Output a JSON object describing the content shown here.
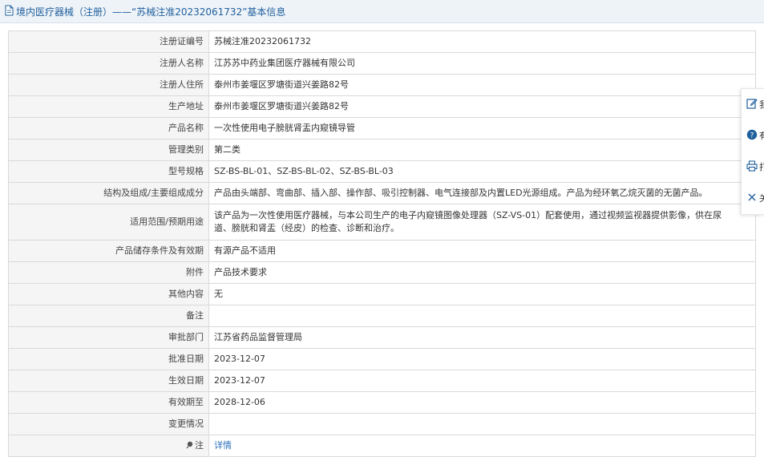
{
  "header": {
    "title": "境内医疗器械（注册）——“苏械注准20232061732”基本信息",
    "icon": "document-icon"
  },
  "rows": [
    {
      "label": "注册证编号",
      "value": "苏械注准20232061732"
    },
    {
      "label": "注册人名称",
      "value": "江苏苏中药业集团医疗器械有限公司"
    },
    {
      "label": "注册人住所",
      "value": "泰州市姜堰区罗塘街道兴姜路82号"
    },
    {
      "label": "生产地址",
      "value": "泰州市姜堰区罗塘街道兴姜路82号"
    },
    {
      "label": "产品名称",
      "value": "一次性使用电子膀胱肾盂内窥镜导管"
    },
    {
      "label": "管理类别",
      "value": "第二类"
    },
    {
      "label": "型号规格",
      "value": "SZ-BS-BL-01、SZ-BS-BL-02、SZ-BS-BL-03"
    },
    {
      "label": "结构及组成/主要组成成分",
      "value": "产品由头端部、弯曲部、插入部、操作部、吸引控制器、电气连接部及内置LED光源组成。产品为经环氧乙烷灭菌的无菌产品。"
    },
    {
      "label": "适用范围/预期用途",
      "value_lines": [
        "该产品为一次性使用医疗器械，与本公司生产的电子内窥镜图像处理器（SZ-VS-01）配套使用，通过视频监视器提供影像，供在尿",
        "道、膀胱和肾盂（经皮）的检查、诊断和治疗。"
      ]
    },
    {
      "label": "产品储存条件及有效期",
      "value": "有源产品不适用"
    },
    {
      "label": "附件",
      "value": "产品技术要求"
    },
    {
      "label": "其他内容",
      "value": "无"
    },
    {
      "label": "备注",
      "value": ""
    },
    {
      "label": "审批部门",
      "value": "江苏省药品监督管理局"
    },
    {
      "label": "批准日期",
      "value": "2023-12-07"
    },
    {
      "label": "生效日期",
      "value": "2023-12-07"
    },
    {
      "label": "有效期至",
      "value": "2028-12-06"
    },
    {
      "label": "变更情况",
      "value": ""
    },
    {
      "label": "注",
      "value": "详情",
      "label_icon": "pin-icon",
      "link": true
    }
  ],
  "side_toolbar": [
    {
      "icon": "edit-icon",
      "label": "我"
    },
    {
      "icon": "help-icon",
      "label": "有"
    },
    {
      "icon": "print-icon",
      "label": "打"
    },
    {
      "icon": "close-icon",
      "label": "关"
    }
  ],
  "colors": {
    "header_bg": "#eef3f8",
    "header_text": "#1f5f9c",
    "label_bg": "#f5f5f5",
    "border": "#d9d9d9",
    "link": "#2a6fba",
    "accent": "#2a6fba"
  }
}
